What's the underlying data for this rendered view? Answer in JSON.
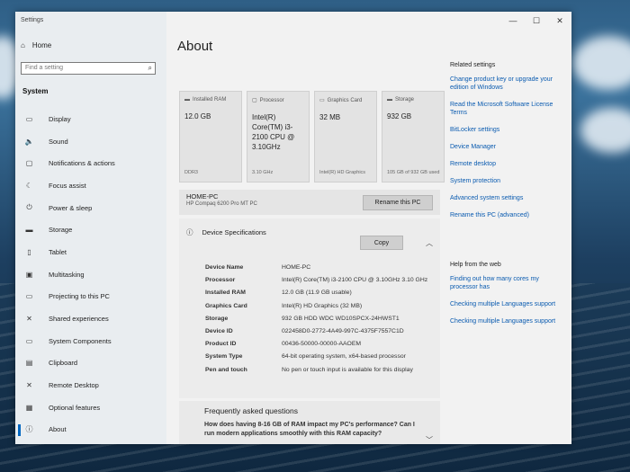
{
  "window": {
    "title": "Settings",
    "controls": [
      "—",
      "☐",
      "✕"
    ]
  },
  "sidebar": {
    "home_label": "Home",
    "search_placeholder": "Find a setting",
    "section_label": "System",
    "items": [
      {
        "label": "Display",
        "icon": "display-icon",
        "glyph": "▭"
      },
      {
        "label": "Sound",
        "icon": "sound-icon",
        "glyph": "🔈"
      },
      {
        "label": "Notifications & actions",
        "icon": "notifications-icon",
        "glyph": "▢"
      },
      {
        "label": "Focus assist",
        "icon": "focus-assist-icon",
        "glyph": "☾"
      },
      {
        "label": "Power & sleep",
        "icon": "power-icon",
        "glyph": "⏻"
      },
      {
        "label": "Storage",
        "icon": "storage-icon",
        "glyph": "▬"
      },
      {
        "label": "Tablet",
        "icon": "tablet-icon",
        "glyph": "▯"
      },
      {
        "label": "Multitasking",
        "icon": "multitasking-icon",
        "glyph": "▣"
      },
      {
        "label": "Projecting to this PC",
        "icon": "projecting-icon",
        "glyph": "▭"
      },
      {
        "label": "Shared experiences",
        "icon": "shared-experiences-icon",
        "glyph": "✕"
      },
      {
        "label": "System Components",
        "icon": "system-components-icon",
        "glyph": "▭"
      },
      {
        "label": "Clipboard",
        "icon": "clipboard-icon",
        "glyph": "▤"
      },
      {
        "label": "Remote Desktop",
        "icon": "remote-desktop-icon",
        "glyph": "✕"
      },
      {
        "label": "Optional features",
        "icon": "optional-features-icon",
        "glyph": "▦"
      },
      {
        "label": "About",
        "icon": "about-icon",
        "glyph": "ⓘ"
      }
    ]
  },
  "main": {
    "title": "About",
    "cards": [
      {
        "label": "Installed RAM",
        "value": "12.0 GB",
        "sub": "DDR3"
      },
      {
        "label": "Processor",
        "value": "Intel(R) Core(TM) i3-2100 CPU @ 3.10GHz",
        "sub": "3.10 GHz"
      },
      {
        "label": "Graphics Card",
        "value": "32 MB",
        "sub": "Intel(R) HD Graphics"
      },
      {
        "label": "Storage",
        "value": "932 GB",
        "sub": "105 GB of 932 GB used"
      }
    ],
    "pc_name": "HOME-PC",
    "pc_model": "HP Compaq 6200 Pro MT PC",
    "rename_label": "Rename this PC",
    "spec_title": "Device Specifications",
    "copy_label": "Copy",
    "specs": [
      {
        "k": "Device Name",
        "v": "HOME-PC"
      },
      {
        "k": "Processor",
        "v": "Intel(R) Core(TM) i3-2100 CPU @ 3.10GHz   3.10 GHz"
      },
      {
        "k": "Installed RAM",
        "v": "12.0 GB (11.9 GB usable)"
      },
      {
        "k": "Graphics Card",
        "v": "Intel(R) HD Graphics (32 MB)"
      },
      {
        "k": "Storage",
        "v": "932 GB HDD WDC WD10SPCX-24HWST1"
      },
      {
        "k": "Device ID",
        "v": "022458D0-2772-4A49-997C-4375F7557C1D"
      },
      {
        "k": "Product ID",
        "v": "00436-50000-00000-AAOEM"
      },
      {
        "k": "System Type",
        "v": "64-bit operating system, x64-based processor"
      },
      {
        "k": "Pen and touch",
        "v": "No pen or touch input is available for this display"
      }
    ],
    "faq_title": "Frequently asked questions",
    "faq_question": "How does having 8-16 GB of RAM impact my PC's performance? Can I run modern applications smoothly with this RAM capacity?"
  },
  "related": {
    "heading": "Related settings",
    "links": [
      "Change product key or upgrade your edition of Windows",
      "Read the Microsoft Software License Terms",
      "BitLocker settings",
      "Device Manager",
      "Remote desktop",
      "System protection",
      "Advanced system settings",
      "Rename this PC (advanced)"
    ]
  },
  "help": {
    "heading": "Help from the web",
    "links": [
      "Finding out how many cores my processor has",
      "Checking multiple Languages support",
      "Checking multiple Languages support"
    ]
  }
}
